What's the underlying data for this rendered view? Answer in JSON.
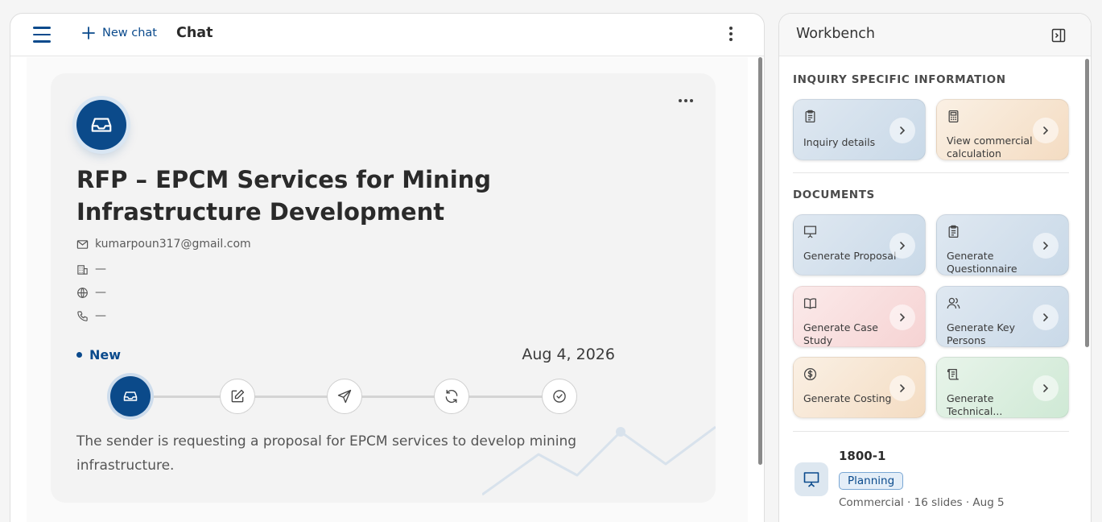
{
  "chat": {
    "new_chat_label": "New chat",
    "title": "Chat",
    "card": {
      "title": "RFP – EPCM Services for Mining Infrastructure Development",
      "email": "kumarpoun317@gmail.com",
      "company": "—",
      "website": "—",
      "phone": "—",
      "status": "New",
      "date": "Aug 4, 2026",
      "summary": "The sender is requesting a proposal for EPCM services to develop mining infrastructure.",
      "steps": [
        "inbox-icon",
        "edit-icon",
        "send-icon",
        "refresh-icon",
        "check-circle-icon"
      ]
    }
  },
  "workbench": {
    "title": "Workbench",
    "inquiry_section": {
      "title": "INQUIRY SPECIFIC INFORMATION",
      "tiles": [
        {
          "label": "Inquiry details",
          "icon": "clipboard-icon",
          "color": "#d3e0ec"
        },
        {
          "label": "View commercial calculation",
          "icon": "calculator-icon",
          "color": "#f6e4d0"
        }
      ]
    },
    "documents_section": {
      "title": "DOCUMENTS",
      "tiles": [
        {
          "label": "Generate Proposal",
          "icon": "presentation-icon",
          "color": "#d3e0ec"
        },
        {
          "label": "Generate Questionnaire",
          "icon": "clipboard-icon",
          "color": "#d3e0ec"
        },
        {
          "label": "Generate Case Study",
          "icon": "book-icon",
          "color": "#f8dede"
        },
        {
          "label": "Generate Key Persons",
          "icon": "users-icon",
          "color": "#d3e0ec"
        },
        {
          "label": "Generate Costing",
          "icon": "dollar-icon",
          "color": "#f6e4d0"
        },
        {
          "label": "Generate Technical...",
          "icon": "scroll-icon",
          "color": "#dbeedf"
        }
      ]
    },
    "recent_document": {
      "name": "1800-1",
      "badge": "Planning",
      "meta": "Commercial · 16 slides · Aug 5"
    }
  },
  "colors": {
    "brand": "#0a4a8c",
    "background": "#f5f5f5"
  }
}
